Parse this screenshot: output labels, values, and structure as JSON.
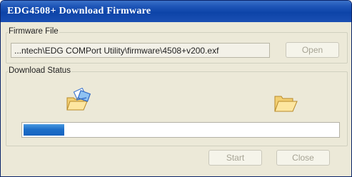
{
  "window": {
    "title": "EDG4508+ Download Firmware"
  },
  "firmware_file": {
    "group_label": "Firmware File",
    "path_value": "...ntech\\EDG COMPort Utility\\firmware\\4508+v200.exf",
    "open_button": "Open"
  },
  "download_status": {
    "group_label": "Download Status",
    "source_icon": "folder-transfer-icon",
    "destination_icon": "folder-open-icon",
    "progress_fraction": 0.13
  },
  "buttons": {
    "start": "Start",
    "close": "Close"
  },
  "colors": {
    "titlebar": "#0d44a8",
    "progress_fill": "#1d6fc8",
    "window_background": "#ece9d8"
  }
}
